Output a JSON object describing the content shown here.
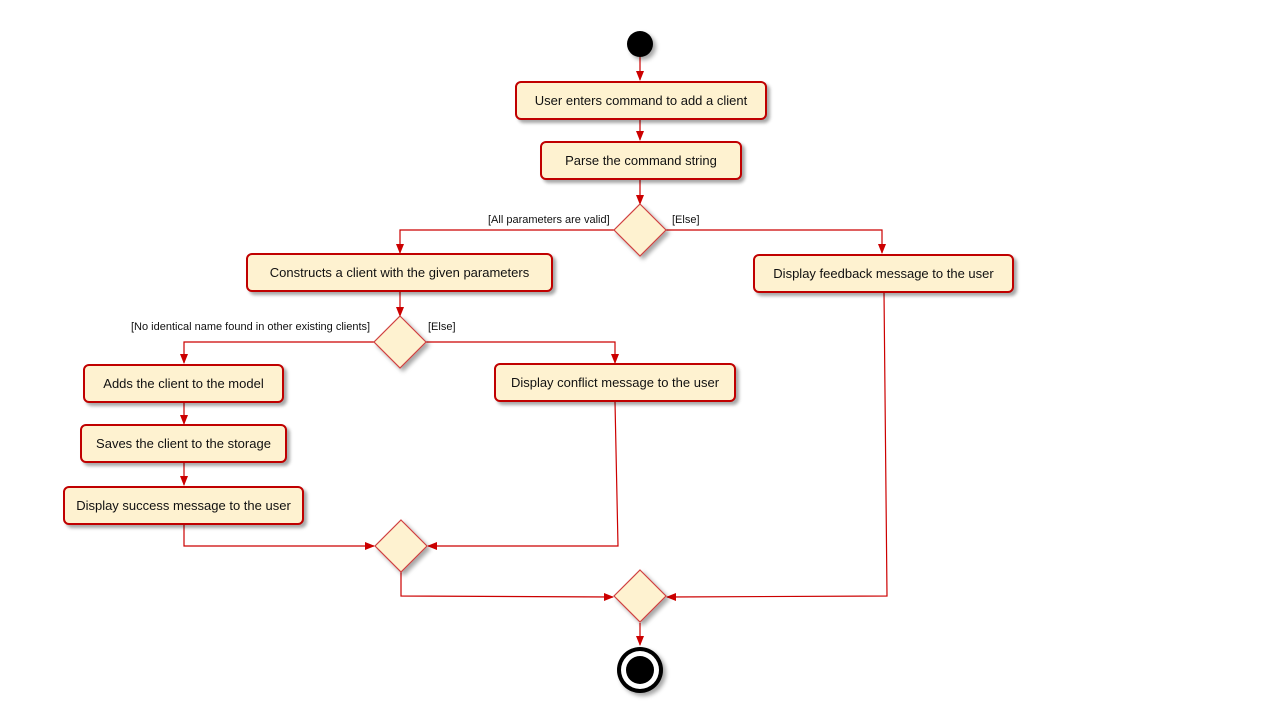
{
  "diagram": {
    "type": "activity",
    "colors": {
      "border": "#c00000",
      "fill": "#fef2d0",
      "line": "#cc0000",
      "node": "#000000"
    },
    "actions": {
      "enter_command": "User enters command to add a  client",
      "parse": "Parse the command string",
      "construct": "Constructs a client with the given parameters",
      "feedback": "Display feedback message to the user",
      "add_model": "Adds the client to the model",
      "conflict": "Display conflict message to the user",
      "save_storage": "Saves the client to the storage",
      "success": "Display success message to the user"
    },
    "guards": {
      "valid": "[All parameters are valid]",
      "else1": "[Else]",
      "no_identical": "[No identical name found in other existing clients]",
      "else2": "[Else]"
    }
  }
}
